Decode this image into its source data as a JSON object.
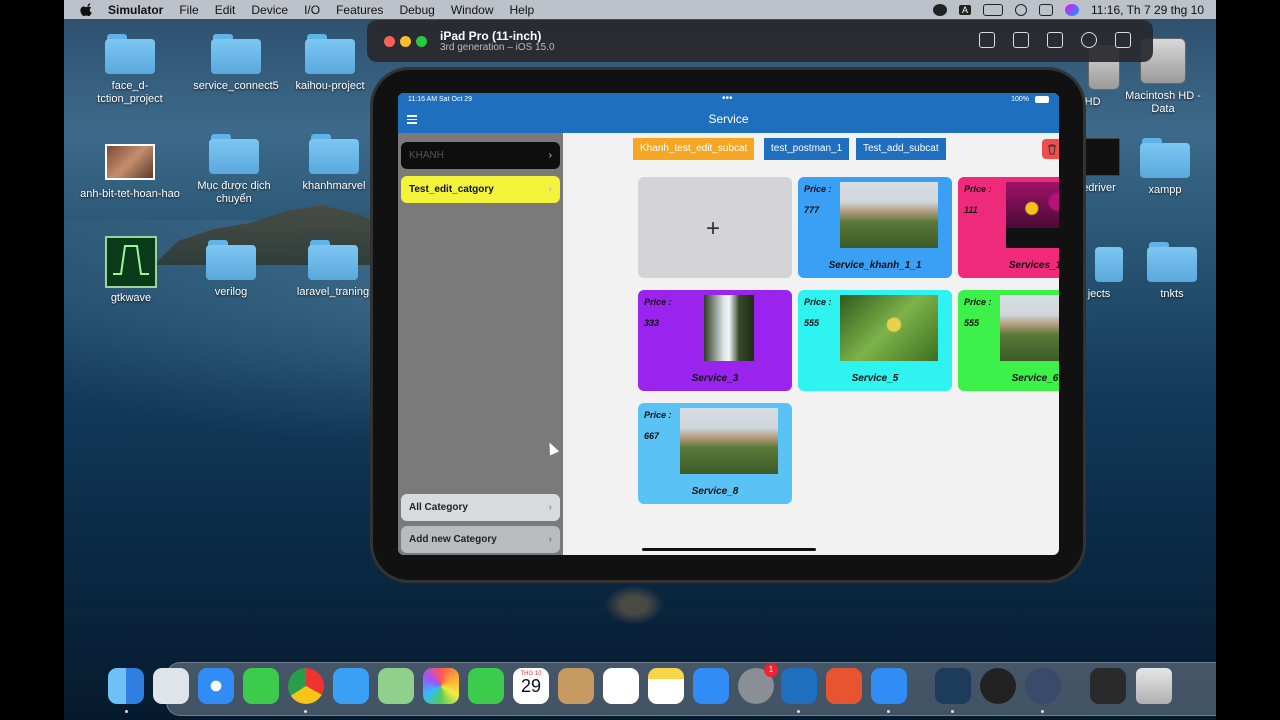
{
  "menubar": {
    "app": "Simulator",
    "items": [
      "File",
      "Edit",
      "Device",
      "I/O",
      "Features",
      "Debug",
      "Window",
      "Help"
    ],
    "status_letter": "A",
    "clock": "11:16, Th 7 29 thg 10"
  },
  "desktop": {
    "icons": [
      {
        "label": "face_d-\ntction_project"
      },
      {
        "label": "service_connect5"
      },
      {
        "label": "kaihou-project"
      },
      {
        "label": "anh-bit-tet-hoan-hao"
      },
      {
        "label": "Mục được dịch chuyển"
      },
      {
        "label": "khanhmarvel"
      },
      {
        "label": "gtkwave"
      },
      {
        "label": "verilog"
      },
      {
        "label": "laravel_traning"
      },
      {
        "label": "h HD"
      },
      {
        "label": "Macintosh HD - Data"
      },
      {
        "label": "edriver"
      },
      {
        "label": "xampp"
      },
      {
        "label": "jects"
      },
      {
        "label": "tnkts"
      }
    ]
  },
  "simulator": {
    "device": "iPad Pro (11-inch)",
    "subtitle": "3rd generation – iOS 15.0"
  },
  "app": {
    "status_time": "11:16 AM  Sat Oct 29",
    "battery": "100%",
    "title": "Service",
    "categories": [
      {
        "label": "KHANH"
      },
      {
        "label": "Test_edit_catgory"
      }
    ],
    "bottom_buttons": [
      {
        "label": "All Category"
      },
      {
        "label": "Add new Category"
      }
    ],
    "subcategories": [
      {
        "label": "Khanh_test_edit_subcat",
        "color": "#f5a623"
      },
      {
        "label": "test_postman_1",
        "color": "#1f6fbf"
      },
      {
        "label": "Test_add_subcat",
        "color": "#1f6fbf"
      }
    ],
    "price_label": "Price :",
    "services": [
      {
        "price": "777",
        "name": "Service_khanh_1_1",
        "color": "#3aa0f5",
        "pic": "meadow"
      },
      {
        "price": "111",
        "name": "Services_1",
        "color": "#f02a7a",
        "pic": "flower"
      },
      {
        "price": "333",
        "name": "Service_3",
        "color": "#9b23ee",
        "pic": "water"
      },
      {
        "price": "555",
        "name": "Service_5",
        "color": "#2ff3f0",
        "pic": "leaf"
      },
      {
        "price": "555",
        "name": "Service_6",
        "color": "#3ef04a",
        "pic": "meadow"
      },
      {
        "price": "667",
        "name": "Service_8",
        "color": "#5ac2f5",
        "pic": "meadow"
      }
    ],
    "add_symbol": "+"
  },
  "dock": {
    "calendar_month": "THG 10",
    "calendar_day": "29",
    "badge_count": "1"
  }
}
